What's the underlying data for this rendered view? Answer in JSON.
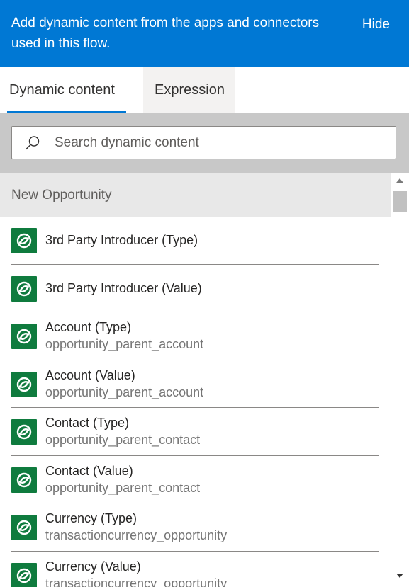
{
  "banner": {
    "message": "Add dynamic content from the apps and connectors used in this flow.",
    "hide_label": "Hide"
  },
  "tabs": [
    {
      "label": "Dynamic content",
      "selected": true
    },
    {
      "label": "Expression",
      "selected": false
    }
  ],
  "search": {
    "placeholder": "Search dynamic content",
    "value": ""
  },
  "section": {
    "title": "New Opportunity"
  },
  "items": [
    {
      "title": "3rd Party Introducer (Type)",
      "subtitle": ""
    },
    {
      "title": "3rd Party Introducer (Value)",
      "subtitle": ""
    },
    {
      "title": "Account (Type)",
      "subtitle": "opportunity_parent_account"
    },
    {
      "title": "Account (Value)",
      "subtitle": "opportunity_parent_account"
    },
    {
      "title": "Contact (Type)",
      "subtitle": "opportunity_parent_contact"
    },
    {
      "title": "Contact (Value)",
      "subtitle": "opportunity_parent_contact"
    },
    {
      "title": "Currency (Type)",
      "subtitle": "transactioncurrency_opportunity"
    },
    {
      "title": "Currency (Value)",
      "subtitle": "transactioncurrency_opportunity"
    }
  ],
  "icons": {
    "search": "search-icon",
    "item": "dataverse-icon"
  },
  "colors": {
    "banner_bg": "#0078d4",
    "accent": "#0078d4",
    "icon_bg": "#0f7b3e",
    "section_bg": "#e8e8e8",
    "search_area_bg": "#c8c8c8"
  }
}
